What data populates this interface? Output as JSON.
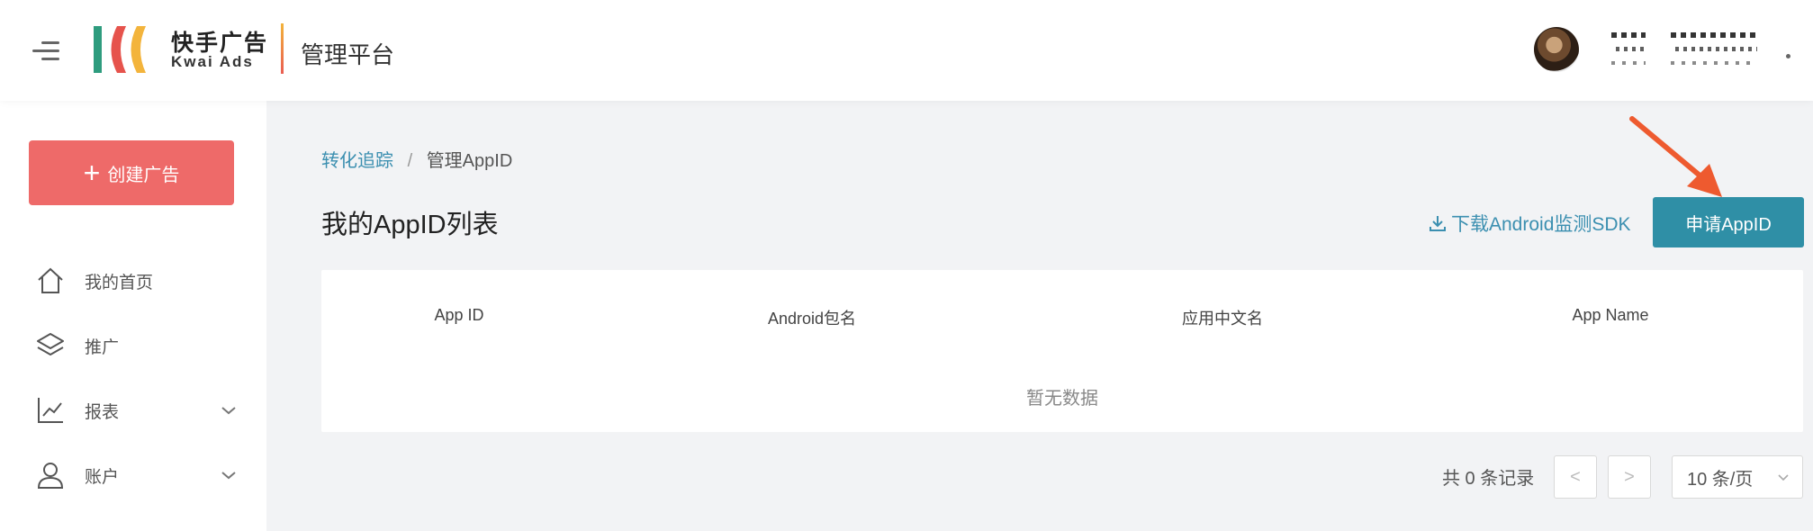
{
  "header": {
    "logo_cn": "快手广告",
    "logo_en": "Kwai Ads",
    "title": "管理平台"
  },
  "sidebar": {
    "create_label": "创建广告",
    "items": [
      {
        "label": "我的首页",
        "icon": "home-icon"
      },
      {
        "label": "推广",
        "icon": "layers-icon"
      },
      {
        "label": "报表",
        "icon": "chart-line-icon"
      },
      {
        "label": "账户",
        "icon": "user-icon"
      }
    ]
  },
  "main": {
    "breadcrumb": {
      "parent": "转化追踪",
      "separator": "/",
      "current": "管理AppID"
    },
    "title": "我的AppID列表",
    "sdk_link": "下载Android监测SDK",
    "apply_button": "申请AppID",
    "table": {
      "columns": [
        "App ID",
        "Android包名",
        "应用中文名",
        "App Name"
      ],
      "empty_text": "暂无数据"
    },
    "pagination": {
      "total": "共 0 条记录",
      "prev": "<",
      "next": ">",
      "page_size": "10 条/页"
    }
  },
  "colors": {
    "create_button": "#ee6a69",
    "primary": "#2f8fa6",
    "link": "#3b8fb0",
    "annotation_arrow": "#ee5a2f"
  }
}
